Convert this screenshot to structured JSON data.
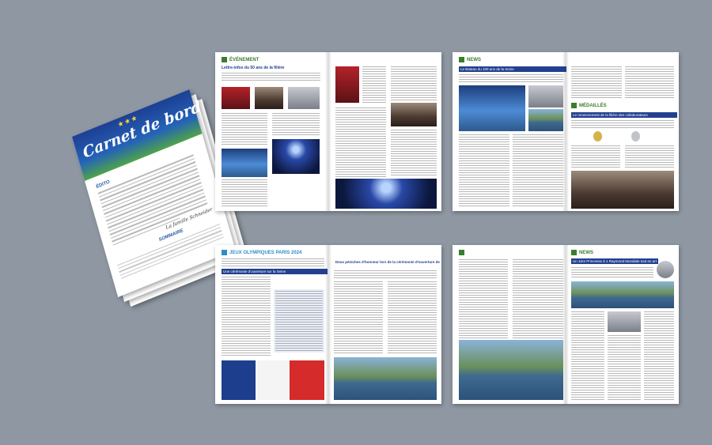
{
  "cover": {
    "title": "Carnet de bord",
    "edito": "ÉDITO",
    "signature": "La famille Schneider",
    "sommaire": "SOMMAIRE"
  },
  "spreads": [
    {
      "id": "evenement",
      "section": "ÉVÉNEMENT",
      "headline": "Lettre-infos du 50 ans de la filière"
    },
    {
      "id": "news-1",
      "section": "NEWS",
      "headline": "Le Bateau du 100 ans de la Seine",
      "section2": "MÉDAILLÉS",
      "headline2": "Le remerciement de la filière des collaborateurs"
    },
    {
      "id": "jo",
      "section": "JEUX OLYMPIQUES PARIS 2024",
      "headline": "Une cérémonie d'ouverture sur la Seine",
      "headline2": "Deux péniches d'honneur lors de la cérémonie d'ouverture des JO de Paris"
    },
    {
      "id": "news-2",
      "section": "NEWS",
      "headline": "Un 1ère Princesse à 1 Raymond Mondiale tout en art"
    }
  ],
  "colors": {
    "background": "#8e97a2",
    "brand_blue": "#22408f",
    "section_green": "#3a7d2e"
  }
}
